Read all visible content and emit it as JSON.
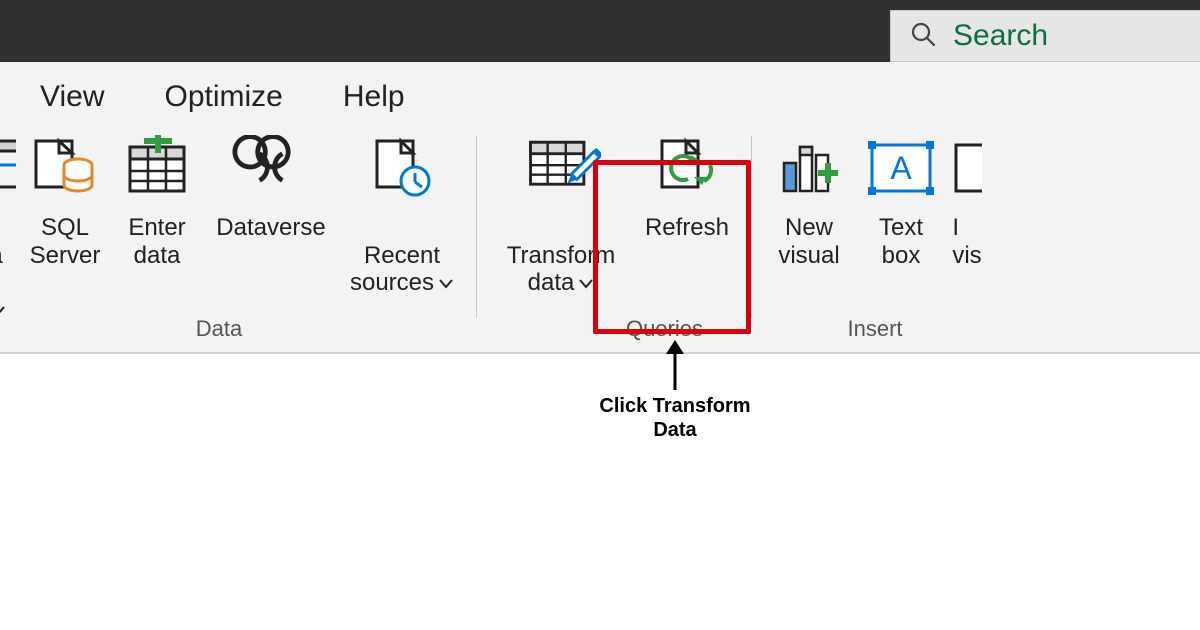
{
  "titlebar": {
    "search_placeholder": "Search"
  },
  "menu": {
    "view": "View",
    "optimize": "Optimize",
    "help": "Help"
  },
  "ribbon": {
    "data_group": {
      "label": "Data",
      "partial_a": "a",
      "sql_server": "SQL\nServer",
      "enter_data": "Enter\ndata",
      "dataverse": "Dataverse",
      "recent_sources": "Recent\nsources"
    },
    "queries_group": {
      "label": "Queries",
      "transform_data": "Transform\ndata",
      "refresh": "Refresh"
    },
    "insert_group": {
      "label": "Insert",
      "new_visual": "New\nvisual",
      "text_box": "Text\nbox",
      "partial_vis": "I\nvis"
    }
  },
  "annotation": {
    "text": "Click Transform\nData"
  }
}
